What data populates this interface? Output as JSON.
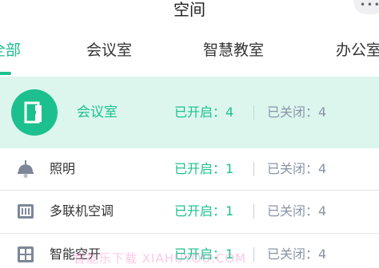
{
  "header": {
    "title": "空间",
    "more_icon": "ellipsis-icon"
  },
  "tabs": [
    {
      "label": "全部",
      "active": true
    },
    {
      "label": "会议室",
      "active": false
    },
    {
      "label": "智慧教室",
      "active": false
    },
    {
      "label": "办公室",
      "active": false
    }
  ],
  "category": {
    "name": "会议室",
    "icon": "door-icon",
    "on_text": "已开启：4",
    "off_text": "已关闭：4"
  },
  "devices": [
    {
      "name": "照明",
      "icon": "lamp-icon",
      "on_text": "已开启：1",
      "off_text": "已关闭：4"
    },
    {
      "name": "多联机空调",
      "icon": "air-conditioner-icon",
      "on_text": "已开启：1",
      "off_text": "已关闭：4"
    },
    {
      "name": "智能空开",
      "icon": "circuit-breaker-icon",
      "on_text": "已开启：1",
      "off_text": "已关闭：4"
    }
  ],
  "watermark": "智能乐下载  XIAHUYOU.COM",
  "colors": {
    "accent": "#1cc08e",
    "accent_light": "#dcf6ee",
    "muted_text": "#8a94a6",
    "separator": "#e6e8eb"
  }
}
